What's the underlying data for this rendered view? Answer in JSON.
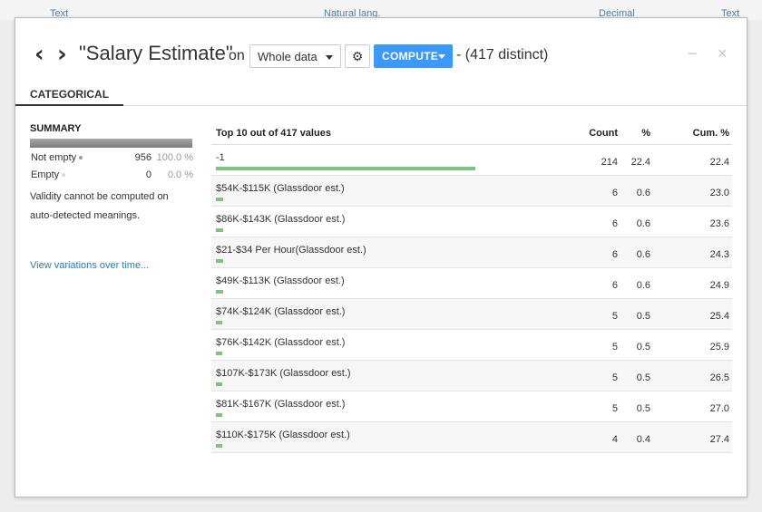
{
  "background_columns": [
    "Text",
    "Natural lang.",
    "Decimal",
    "Text"
  ],
  "header": {
    "title": "\"Salary Estimate\"",
    "on_label": "on",
    "sample_select": "Whole data",
    "compute_label": "COMPUTE",
    "distinct_label": "- (417 distinct)",
    "minimize": "−",
    "close": "×"
  },
  "tabs": [
    {
      "label": "CATEGORICAL"
    }
  ],
  "summary": {
    "title": "SUMMARY",
    "not_empty": {
      "label": "Not empty",
      "count": "956",
      "pct": "100.0 %"
    },
    "empty": {
      "label": "Empty",
      "count": "0",
      "pct": "0.0 %"
    },
    "validity_note": "Validity cannot be computed on auto-detected meanings.",
    "variations_link": "View variations over time..."
  },
  "table": {
    "headers": {
      "value": "Top 10 out of 417 values",
      "count": "Count",
      "pct": "%",
      "cum": "Cum. %"
    },
    "rows": [
      {
        "value": "-1",
        "count": "214",
        "pct": "22.4",
        "cum": "22.4"
      },
      {
        "value": "$54K-$115K (Glassdoor est.)",
        "count": "6",
        "pct": "0.6",
        "cum": "23.0"
      },
      {
        "value": "$86K-$143K (Glassdoor est.)",
        "count": "6",
        "pct": "0.6",
        "cum": "23.6"
      },
      {
        "value": "$21-$34 Per Hour(Glassdoor est.)",
        "count": "6",
        "pct": "0.6",
        "cum": "24.3"
      },
      {
        "value": "$49K-$113K (Glassdoor est.)",
        "count": "6",
        "pct": "0.6",
        "cum": "24.9"
      },
      {
        "value": "$74K-$124K (Glassdoor est.)",
        "count": "5",
        "pct": "0.5",
        "cum": "25.4"
      },
      {
        "value": "$76K-$142K (Glassdoor est.)",
        "count": "5",
        "pct": "0.5",
        "cum": "25.9"
      },
      {
        "value": "$107K-$173K (Glassdoor est.)",
        "count": "5",
        "pct": "0.5",
        "cum": "26.5"
      },
      {
        "value": "$81K-$167K (Glassdoor est.)",
        "count": "5",
        "pct": "0.5",
        "cum": "27.0"
      },
      {
        "value": "$110K-$175K (Glassdoor est.)",
        "count": "4",
        "pct": "0.4",
        "cum": "27.4"
      }
    ]
  },
  "colors": {
    "compute_button": "#3b99fc",
    "frequency_bar": "#7ec47c",
    "link": "#2d7bb6",
    "not_empty_dot": "#9a9a9a",
    "empty_dot": "#d8d8d8"
  },
  "icons": {
    "prev": "chevron-left-icon",
    "next": "chevron-right-icon",
    "settings": "gear-icon",
    "dropdown": "caret-down-icon"
  }
}
